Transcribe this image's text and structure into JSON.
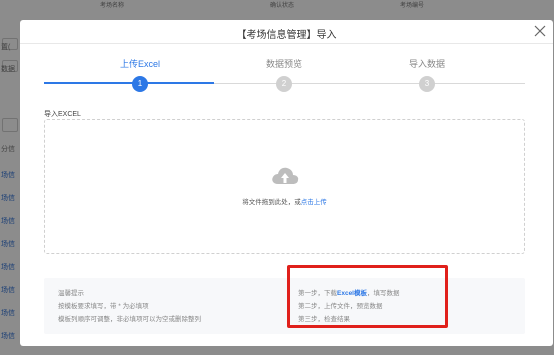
{
  "background": {
    "header_cells": [
      "考场名称",
      "确认状态",
      "考场编号"
    ],
    "left_fragments": [
      "置(",
      "数据",
      "分信",
      "场信",
      "场信",
      "场信",
      "场信",
      "场信",
      "场信",
      "场信",
      "场信"
    ]
  },
  "modal": {
    "title": "【考场信息管理】导入",
    "close_label": "×"
  },
  "steps": [
    {
      "label": "上传Excel",
      "number": "1",
      "active": true
    },
    {
      "label": "数据预览",
      "number": "2",
      "active": false
    },
    {
      "label": "导入数据",
      "number": "3",
      "active": false
    }
  ],
  "upload": {
    "section_label": "导入EXCEL",
    "drop_text": "将文件拖到此处，或",
    "drop_link": "点击上传",
    "icon": "cloud-upload-icon"
  },
  "tips": {
    "title": "温馨提示",
    "left_lines": [
      "按模板要求填写，带 * 为必填项",
      "模板列顺序可调整，非必填项可以为空或删除整列"
    ],
    "right_line1_prefix": "第一步，下载",
    "right_line1_link": "Excel模板",
    "right_line1_suffix": "，填写数据",
    "right_line2": "第二步，上传文件，预览数据",
    "right_line3": "第三步，检查结果"
  },
  "colors": {
    "accent": "#2d78e6",
    "highlight": "#e0201b"
  }
}
